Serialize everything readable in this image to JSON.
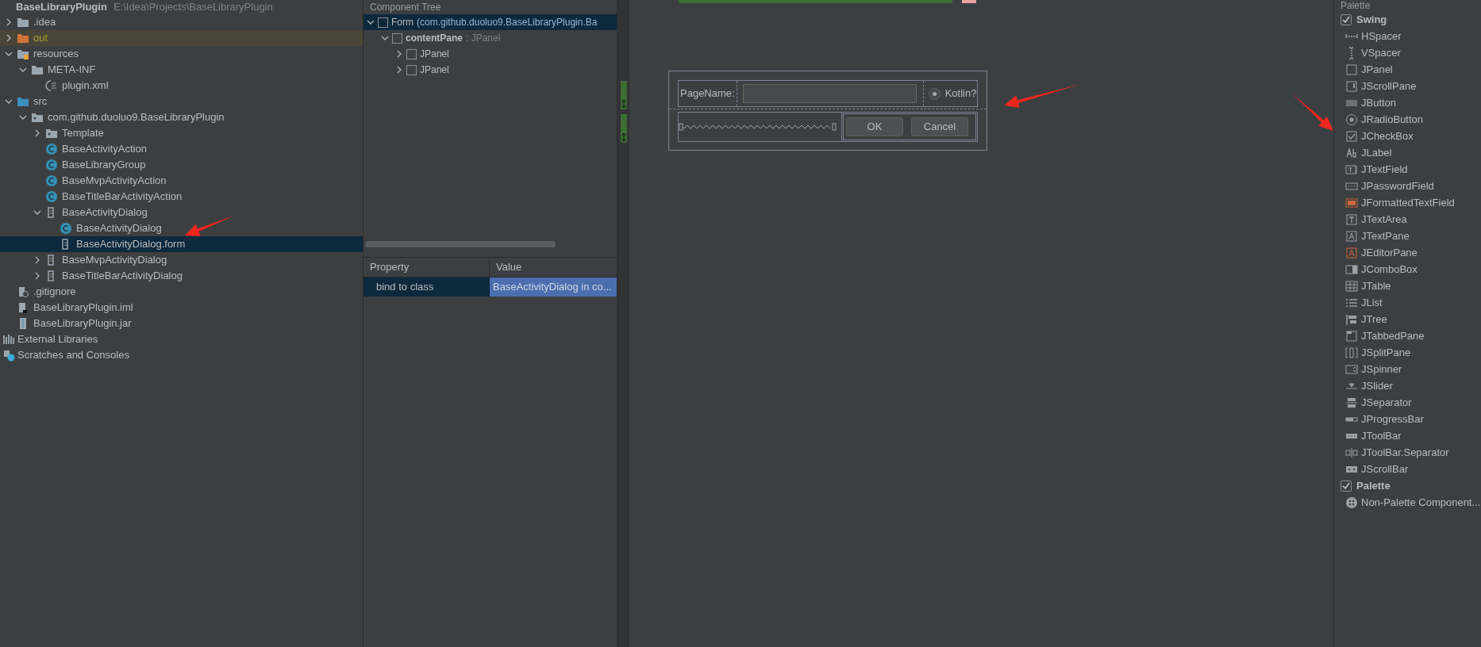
{
  "project": {
    "title": "BaseLibraryPlugin",
    "path": "E:\\Idea\\Projects\\BaseLibraryPlugin",
    "tree": [
      {
        "label": ".idea",
        "kind": "folder",
        "expanded": false,
        "selected": false,
        "excluded": false
      },
      {
        "label": "out",
        "kind": "folder-excluded",
        "expanded": false,
        "selected": false,
        "excluded": true
      },
      {
        "label": "resources",
        "kind": "folder-resources",
        "expanded": true,
        "selected": false,
        "excluded": false,
        "children": [
          {
            "label": "META-INF",
            "kind": "folder",
            "expanded": true,
            "selected": false,
            "excluded": false,
            "children": [
              {
                "label": "plugin.xml",
                "kind": "xml",
                "selected": false,
                "excluded": false
              }
            ]
          }
        ]
      },
      {
        "label": "src",
        "kind": "folder-source",
        "expanded": true,
        "selected": false,
        "excluded": false,
        "children": [
          {
            "label": "com.github.duoluo9.BaseLibraryPlugin",
            "kind": "package",
            "expanded": true,
            "selected": false,
            "excluded": false,
            "children": [
              {
                "label": "Template",
                "kind": "package",
                "expanded": false,
                "selected": false,
                "excluded": false
              },
              {
                "label": "BaseActivityAction",
                "kind": "class",
                "selected": false,
                "excluded": false
              },
              {
                "label": "BaseLibraryGroup",
                "kind": "class",
                "selected": false,
                "excluded": false
              },
              {
                "label": "BaseMvpActivityAction",
                "kind": "class",
                "selected": false,
                "excluded": false
              },
              {
                "label": "BaseTitleBarActivityAction",
                "kind": "class",
                "selected": false,
                "excluded": false
              },
              {
                "label": "BaseActivityDialog",
                "kind": "form",
                "expanded": true,
                "selected": false,
                "excluded": false,
                "children": [
                  {
                    "label": "BaseActivityDialog",
                    "kind": "class",
                    "selected": false,
                    "excluded": false
                  },
                  {
                    "label": "BaseActivityDialog.form",
                    "kind": "form",
                    "selected": true,
                    "excluded": false
                  }
                ]
              },
              {
                "label": "BaseMvpActivityDialog",
                "kind": "form",
                "expanded": false,
                "selected": false,
                "excluded": false
              },
              {
                "label": "BaseTitleBarActivityDialog",
                "kind": "form",
                "expanded": false,
                "selected": false,
                "excluded": false
              }
            ]
          }
        ]
      },
      {
        "label": ".gitignore",
        "kind": "ignore-file",
        "selected": false,
        "excluded": false
      },
      {
        "label": "BaseLibraryPlugin.iml",
        "kind": "module-file",
        "selected": false,
        "excluded": false
      },
      {
        "label": "BaseLibraryPlugin.jar",
        "kind": "jar",
        "selected": false,
        "excluded": false
      }
    ],
    "extra": [
      {
        "label": "External Libraries",
        "kind": "libraries"
      },
      {
        "label": "Scratches and Consoles",
        "kind": "scratches"
      }
    ]
  },
  "component_tree": {
    "title": "Component Tree",
    "items": [
      {
        "name": "Form",
        "type": "(com.github.duoluo9.BaseLibraryPlugin.Ba",
        "bold": false,
        "expanded": true,
        "selected": true,
        "checked": false,
        "children": [
          {
            "name": "contentPane",
            "type": ": JPanel",
            "bold": true,
            "expanded": true,
            "selected": false,
            "checked": false,
            "children": [
              {
                "name": "JPanel",
                "bold": false,
                "expanded": false,
                "selected": false,
                "checked": false
              },
              {
                "name": "JPanel",
                "bold": false,
                "expanded": false,
                "selected": false,
                "checked": false
              }
            ]
          }
        ]
      }
    ]
  },
  "properties": {
    "columns": [
      "Property",
      "Value"
    ],
    "rows": [
      {
        "property": "bind to class",
        "value": "BaseActivityDialog in co...",
        "selected": true
      }
    ]
  },
  "form_preview": {
    "label": "PageName:",
    "radio": {
      "label": "Kotlin?",
      "checked": true
    },
    "buttons": [
      "OK",
      "Cancel"
    ]
  },
  "palette": {
    "title": "Palette",
    "groups": [
      {
        "name": "Swing",
        "checked": true,
        "items": [
          {
            "label": "HSpacer",
            "kind": "hspacer"
          },
          {
            "label": "VSpacer",
            "kind": "vspacer"
          },
          {
            "label": "JPanel",
            "kind": "panel"
          },
          {
            "label": "JScrollPane",
            "kind": "scrollpane"
          },
          {
            "label": "JButton",
            "kind": "button"
          },
          {
            "label": "JRadioButton",
            "kind": "radio"
          },
          {
            "label": "JCheckBox",
            "kind": "checkbox"
          },
          {
            "label": "JLabel",
            "kind": "label"
          },
          {
            "label": "JTextField",
            "kind": "textfield"
          },
          {
            "label": "JPasswordField",
            "kind": "password"
          },
          {
            "label": "JFormattedTextField",
            "kind": "formatted"
          },
          {
            "label": "JTextArea",
            "kind": "textarea"
          },
          {
            "label": "JTextPane",
            "kind": "textpane"
          },
          {
            "label": "JEditorPane",
            "kind": "editorpane"
          },
          {
            "label": "JComboBox",
            "kind": "combobox"
          },
          {
            "label": "JTable",
            "kind": "table"
          },
          {
            "label": "JList",
            "kind": "list"
          },
          {
            "label": "JTree",
            "kind": "tree"
          },
          {
            "label": "JTabbedPane",
            "kind": "tabbed"
          },
          {
            "label": "JSplitPane",
            "kind": "split"
          },
          {
            "label": "JSpinner",
            "kind": "spinner"
          },
          {
            "label": "JSlider",
            "kind": "slider"
          },
          {
            "label": "JSeparator",
            "kind": "separator"
          },
          {
            "label": "JProgressBar",
            "kind": "progress"
          },
          {
            "label": "JToolBar",
            "kind": "toolbar"
          },
          {
            "label": "JToolBar.Separator",
            "kind": "toolbarsep"
          },
          {
            "label": "JScrollBar",
            "kind": "scrollbar"
          }
        ]
      },
      {
        "name": "Palette",
        "checked": true,
        "items": [
          {
            "label": "Non-Palette Component...",
            "kind": "component"
          }
        ]
      }
    ]
  }
}
